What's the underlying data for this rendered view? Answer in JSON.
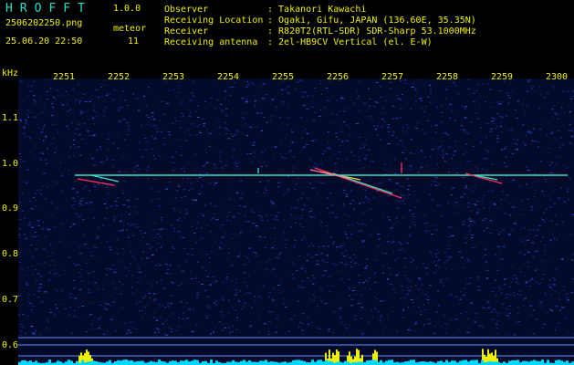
{
  "app": {
    "name": "HROFFT",
    "version": "1.0.0"
  },
  "file": {
    "name": "2506202250.png",
    "datetime": "25.06.20 22:50"
  },
  "meteor": {
    "label": "meteor",
    "count": "11"
  },
  "info": [
    {
      "label": "Observer",
      "value": ": Takanori Kawachi"
    },
    {
      "label": "Receiving Location",
      "value": ": Ogaki, Gifu, JAPAN (136.60E, 35.35N)"
    },
    {
      "label": "Receiver",
      "value": ": R820T2(RTL-SDR) SDR-Sharp 53.1000MHz"
    },
    {
      "label": "Receiving antenna",
      "value": ": 2el-HB9CV Vertical (el. E-W)"
    }
  ],
  "axis": {
    "unit": "kHz",
    "x_ticks": [
      "2251",
      "2252",
      "2253",
      "2254",
      "2255",
      "2256",
      "2257",
      "2258",
      "2259",
      "2300"
    ],
    "y_ticks": [
      "1.1",
      "1.0",
      "0.9",
      "0.8",
      "0.7",
      "0.6"
    ]
  },
  "colors": {
    "background": "#000000",
    "noise": "#1428b4",
    "trace": "#39e0c0",
    "meteor": "#ff3060",
    "bars": "#f0f000",
    "baseline": "#00d8ff"
  }
}
